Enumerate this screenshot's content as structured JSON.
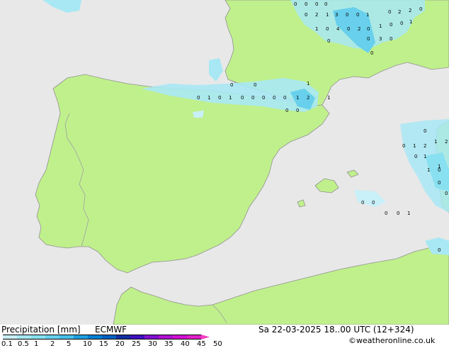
{
  "colors": {
    "sea": "#e8e8e8",
    "land": "#c0f08c",
    "border": "#a0a0a0",
    "coast": "#909090"
  },
  "footer": {
    "title": "Precipitation [mm]",
    "model": "ECMWF",
    "datetime": "Sa 22-03-2025 18..00 UTC (12+324)",
    "copyright": "©weatheronline.co.uk"
  },
  "legend": {
    "ticks": [
      "0.1",
      "0.5",
      "1",
      "2",
      "5",
      "10",
      "15",
      "20",
      "25",
      "30",
      "35",
      "40",
      "45",
      "50"
    ],
    "colors": [
      "#c8f0f8",
      "#a8e8f4",
      "#88e0f0",
      "#68d0ec",
      "#48c0e8",
      "#20a0e0",
      "#0080d0",
      "#0060c0",
      "#1030a0",
      "#4010c0",
      "#8010d0",
      "#b010d0",
      "#d010d0",
      "#e020c8",
      "#f040c0"
    ]
  },
  "markers": [
    "0",
    "0",
    "0",
    "0",
    "0",
    "2",
    "1",
    "3",
    "0",
    "0",
    "1",
    "0",
    "2",
    "2",
    "0",
    "1",
    "0",
    "4",
    "0",
    "2",
    "0",
    "1",
    "0",
    "0",
    "1",
    "0",
    "3",
    "0",
    "0",
    "0",
    "0",
    "1",
    "0",
    "1",
    "0",
    "0",
    "0",
    "0",
    "0",
    "1",
    "2",
    "1",
    "0",
    "0",
    "1",
    "0",
    "0",
    "0",
    "0",
    "1",
    "2",
    "1",
    "2",
    "0",
    "1",
    "1",
    "1",
    "0",
    "0",
    "0",
    "0",
    "0",
    "0",
    "0",
    "1",
    "0"
  ]
}
